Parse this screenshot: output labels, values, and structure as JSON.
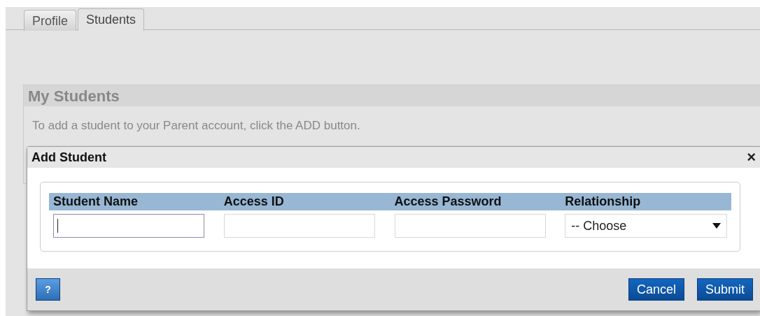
{
  "tabs": [
    {
      "label": "Profile",
      "selected": false
    },
    {
      "label": "Students",
      "selected": true
    }
  ],
  "panel": {
    "title": "My Students",
    "text": "To add a student to your Parent account, click the ADD button."
  },
  "dialog": {
    "title": "Add Student",
    "close": "×",
    "fields": [
      {
        "kind": "text",
        "label": "Student Name",
        "focused": true
      },
      {
        "kind": "text",
        "label": "Access ID",
        "focused": false
      },
      {
        "kind": "text",
        "label": "Access Password",
        "focused": false
      },
      {
        "kind": "select",
        "label": "Relationship",
        "value": "-- Choose",
        "focused": false
      }
    ],
    "help": "?",
    "buttons": [
      "Cancel",
      "Submit"
    ]
  }
}
